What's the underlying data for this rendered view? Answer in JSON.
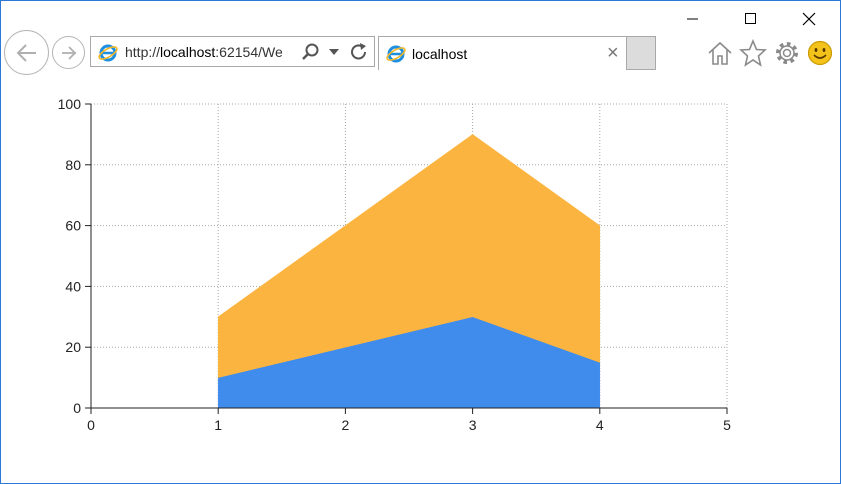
{
  "window": {
    "caption_buttons": [
      "minimize-icon",
      "maximize-icon",
      "close-icon"
    ]
  },
  "navigation": {
    "back_icon": "arrow-left-icon",
    "forward_icon": "arrow-right-icon"
  },
  "address_bar": {
    "url_prefix": "http://",
    "url_host": "localhost",
    "url_rest": ":62154/We",
    "icons": [
      "ie-logo-icon",
      "search-icon",
      "dropdown-icon",
      "refresh-icon"
    ]
  },
  "tab": {
    "title": "localhost",
    "close_glyph": "×"
  },
  "toolbar": {
    "icons": [
      "home-icon",
      "favorites-star-icon",
      "settings-gear-icon",
      "smiley-feedback-icon"
    ]
  },
  "colors": {
    "window_border": "#2b78d6",
    "series_lower": "#3f8ced",
    "series_upper": "#fbb43f",
    "smiley": "#f3c31b"
  },
  "chart_data": {
    "type": "area",
    "stacked": true,
    "x": [
      1,
      2,
      3,
      4
    ],
    "series": [
      {
        "values": [
          10,
          20,
          30,
          15
        ],
        "color": "#3f8ced"
      },
      {
        "values": [
          20,
          40,
          60,
          45
        ],
        "color": "#fbb43f"
      }
    ],
    "xlim": [
      0,
      5
    ],
    "ylim": [
      0,
      100
    ],
    "x_ticks": [
      "0",
      "1",
      "2",
      "3",
      "4",
      "5"
    ],
    "y_ticks": [
      "0",
      "20",
      "40",
      "60",
      "80",
      "100"
    ],
    "grid": true,
    "legend": "none"
  }
}
